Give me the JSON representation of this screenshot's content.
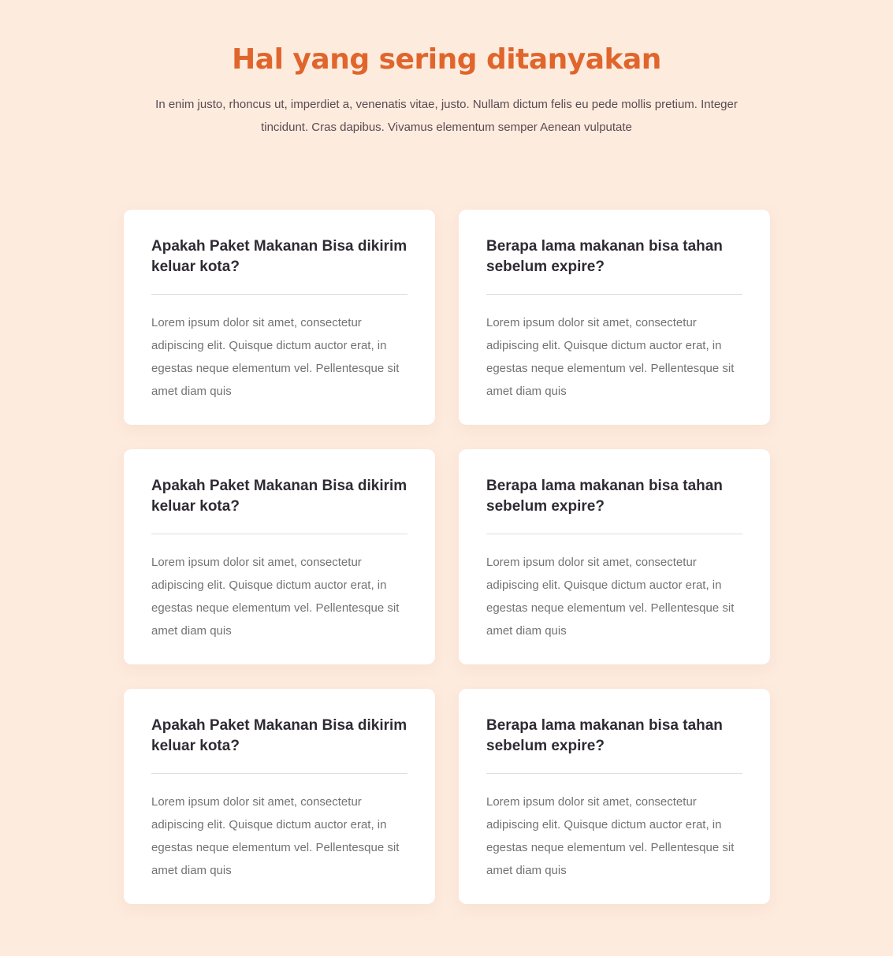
{
  "header": {
    "title": "Hal yang sering ditanyakan",
    "subtitle": "In enim justo, rhoncus ut, imperdiet a, venenatis vitae, justo. Nullam dictum felis eu pede mollis pretium. Integer tincidunt. Cras dapibus. Vivamus elementum semper Aenean vulputate"
  },
  "colors": {
    "background": "#fdebde",
    "title_accent": "#e0652c",
    "card": "#ffffff",
    "question_text": "#2f2a33",
    "answer_text": "#727272"
  },
  "faq": [
    {
      "question": "Apakah Paket Makanan Bisa dikirim keluar kota?",
      "answer": "Lorem ipsum dolor sit amet, consectetur adipiscing elit. Quisque dictum auctor erat, in egestas neque elementum vel. Pellentesque sit amet diam quis"
    },
    {
      "question": "Berapa lama makanan bisa tahan sebelum expire?",
      "answer": "Lorem ipsum dolor sit amet, consectetur adipiscing elit. Quisque dictum auctor erat, in egestas neque elementum vel. Pellentesque sit amet diam quis"
    },
    {
      "question": "Apakah Paket Makanan Bisa dikirim keluar kota?",
      "answer": "Lorem ipsum dolor sit amet, consectetur adipiscing elit. Quisque dictum auctor erat, in egestas neque elementum vel. Pellentesque sit amet diam quis"
    },
    {
      "question": "Berapa lama makanan bisa tahan sebelum expire?",
      "answer": "Lorem ipsum dolor sit amet, consectetur adipiscing elit. Quisque dictum auctor erat, in egestas neque elementum vel. Pellentesque sit amet diam quis"
    },
    {
      "question": "Apakah Paket Makanan Bisa dikirim keluar kota?",
      "answer": "Lorem ipsum dolor sit amet, consectetur adipiscing elit. Quisque dictum auctor erat, in egestas neque elementum vel. Pellentesque sit amet diam quis"
    },
    {
      "question": "Berapa lama makanan bisa tahan sebelum expire?",
      "answer": "Lorem ipsum dolor sit amet, consectetur adipiscing elit. Quisque dictum auctor erat, in egestas neque elementum vel. Pellentesque sit amet diam quis"
    }
  ]
}
